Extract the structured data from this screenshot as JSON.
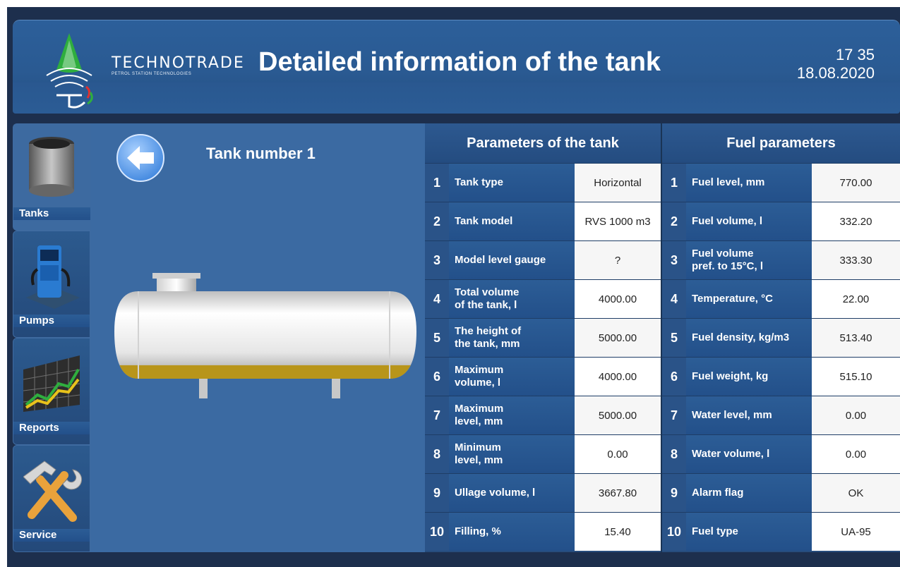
{
  "header": {
    "title": "Detailed information of the tank",
    "time": "17 35",
    "date": "18.08.2020",
    "logo": {
      "name": "TECHNOTRADE",
      "tagline": "PETROL STATION TECHNOLOGIES"
    }
  },
  "sidebar": {
    "items": [
      {
        "label": "Tanks",
        "icon": "tank-icon",
        "active": true
      },
      {
        "label": "Pumps",
        "icon": "fuel-pump-icon",
        "active": false
      },
      {
        "label": "Reports",
        "icon": "chart-icon",
        "active": false
      },
      {
        "label": "Service",
        "icon": "tools-icon",
        "active": false
      }
    ]
  },
  "tank_panel": {
    "title": "Tank number 1",
    "back_icon": "arrow-left-icon",
    "fill_fraction": 0.154
  },
  "tank_params": {
    "header": "Parameters of the tank",
    "rows": [
      {
        "num": "1",
        "label": "Tank type",
        "value": "Horizontal"
      },
      {
        "num": "2",
        "label": "Tank model",
        "value": "RVS 1000 m3"
      },
      {
        "num": "3",
        "label": "Model level gauge",
        "value": "?"
      },
      {
        "num": "4",
        "label": "Total volume\nof the tank, l",
        "value": "4000.00"
      },
      {
        "num": "5",
        "label": "The height of\nthe tank, mm",
        "value": "5000.00"
      },
      {
        "num": "6",
        "label": "Maximum\nvolume, l",
        "value": "4000.00"
      },
      {
        "num": "7",
        "label": "Maximum\nlevel, mm",
        "value": "5000.00"
      },
      {
        "num": "8",
        "label": "Minimum\nlevel, mm",
        "value": "0.00"
      },
      {
        "num": "9",
        "label": "Ullage volume, l",
        "value": "3667.80"
      },
      {
        "num": "10",
        "label": "Filling, %",
        "value": "15.40"
      }
    ]
  },
  "fuel_params": {
    "header": "Fuel parameters",
    "rows": [
      {
        "num": "1",
        "label": "Fuel level, mm",
        "value": "770.00"
      },
      {
        "num": "2",
        "label": "Fuel volume, l",
        "value": "332.20"
      },
      {
        "num": "3",
        "label": "Fuel volume\npref. to 15°C, l",
        "value": "333.30"
      },
      {
        "num": "4",
        "label": "Temperature, °C",
        "value": "22.00"
      },
      {
        "num": "5",
        "label": "Fuel density, kg/m3",
        "value": "513.40"
      },
      {
        "num": "6",
        "label": "Fuel weight, kg",
        "value": "515.10"
      },
      {
        "num": "7",
        "label": "Water level, mm",
        "value": "0.00"
      },
      {
        "num": "8",
        "label": "Water volume, l",
        "value": "0.00"
      },
      {
        "num": "9",
        "label": "Alarm flag",
        "value": "OK"
      },
      {
        "num": "10",
        "label": "Fuel type",
        "value": "UA-95"
      }
    ]
  },
  "colors": {
    "accent": "#2c5f9a",
    "fuel": "#b8951a",
    "logo_green": "#2fae3e"
  }
}
